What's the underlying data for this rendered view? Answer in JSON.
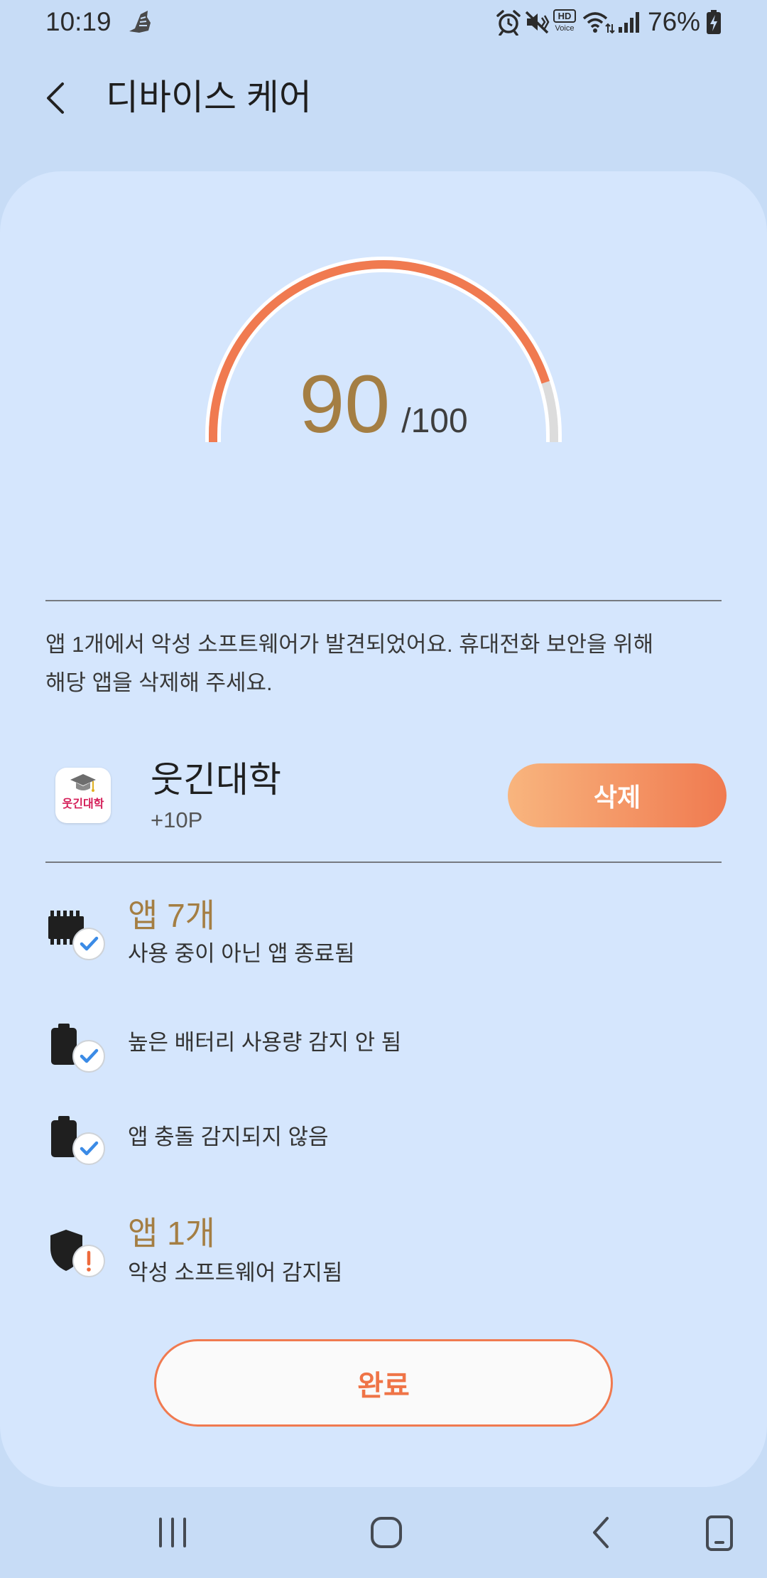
{
  "status_bar": {
    "time": "10:19",
    "battery_percent": "76%",
    "hd_voice": {
      "hd": "HD",
      "voice": "Voice"
    },
    "icons": [
      "notification-app-icon",
      "alarm-icon",
      "mute-icon",
      "hd-voice-icon",
      "wifi-icon",
      "signal-icon",
      "battery-charging-icon"
    ]
  },
  "header": {
    "back_icon": "back-chevron-icon",
    "title": "디바이스 케어"
  },
  "score": {
    "value": "90",
    "max_label": "/100",
    "gauge_fill_percent": 90
  },
  "message": {
    "lines": [
      "앱 1개에서 악성 소프트웨어가 발견되었어요. 휴대전화 보안을 위해",
      "해당 앱을 삭제해 주세요."
    ]
  },
  "malware_app": {
    "icon_label": "웃긴대학",
    "name": "웃긴대학",
    "points": "+10P",
    "delete_label": "삭제"
  },
  "checks": [
    {
      "icon": "memory-chip-icon",
      "badge": "check-badge-icon",
      "title": "앱 7개",
      "description": "사용 중이 아닌 앱 종료됨"
    },
    {
      "icon": "battery-icon",
      "badge": "check-badge-icon",
      "description": "높은 배터리 사용량 감지 안 됨"
    },
    {
      "icon": "battery-icon",
      "badge": "check-badge-icon",
      "description": "앱 충돌 감지되지 않음"
    },
    {
      "icon": "shield-icon",
      "badge": "warning-badge-icon",
      "title": "앱 1개",
      "description": "악성 소프트웨어 감지됨"
    }
  ],
  "done_label": "완료",
  "nav_bar": {
    "icons": [
      "recents-icon",
      "home-icon",
      "back-icon",
      "phone-outline-icon"
    ]
  },
  "colors": {
    "background": "#c7dcf6",
    "card_background": "#d5e6fd",
    "accent_orange": "#f07a50",
    "accent_orange_light": "#f8b57e",
    "score_gold": "#a47e43",
    "check_blue": "#3b8be6",
    "warning_orange": "#ee6a3c",
    "gauge_track": "#dcdcdc"
  }
}
